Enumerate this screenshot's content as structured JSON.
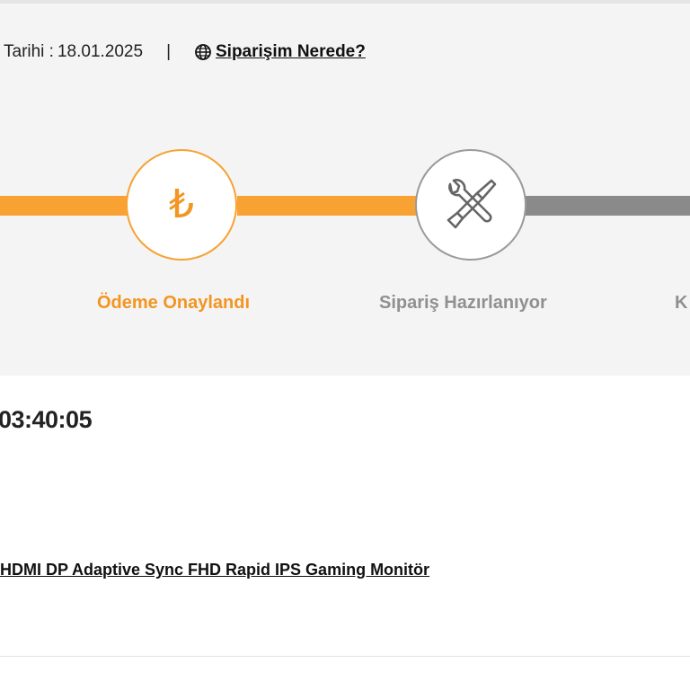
{
  "order_info": {
    "date_label": "Tarihi :",
    "date_value": "18.01.2025",
    "separator": "|",
    "track_link_label": "Siparişim Nerede?"
  },
  "progress": {
    "steps": [
      {
        "label": "Ödeme Onaylandı",
        "icon": "lira-icon",
        "glyph": "₺",
        "state": "active"
      },
      {
        "label": "Sipariş Hazırlanıyor",
        "icon": "tools-icon",
        "state": "pending"
      },
      {
        "label": "K",
        "state": "pending"
      }
    ]
  },
  "timer": {
    "value": "03:40:05"
  },
  "product": {
    "name": "HDMI DP Adaptive Sync FHD Rapid IPS Gaming Monitör"
  },
  "colors": {
    "accent": "#f7a233",
    "accent_text": "#f39521",
    "inactive": "#8a8a8a",
    "panel_bg": "#f4f4f4"
  }
}
